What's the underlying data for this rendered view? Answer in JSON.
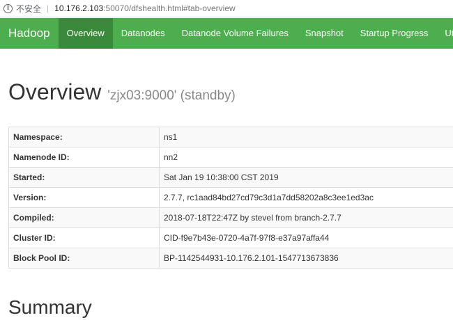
{
  "browser": {
    "security_label": "不安全",
    "url_host": "10.176.2.103",
    "url_rest": ":50070/dfshealth.html#tab-overview"
  },
  "navbar": {
    "brand": "Hadoop",
    "items": [
      "Overview",
      "Datanodes",
      "Datanode Volume Failures",
      "Snapshot",
      "Startup Progress",
      "Utilities"
    ]
  },
  "overview": {
    "title": "Overview",
    "subtitle": "'zjx03:9000' (standby)",
    "rows": [
      {
        "label": "Namespace:",
        "value": "ns1"
      },
      {
        "label": "Namenode ID:",
        "value": "nn2"
      },
      {
        "label": "Started:",
        "value": "Sat Jan 19 10:38:00 CST 2019"
      },
      {
        "label": "Version:",
        "value": "2.7.7, rc1aad84bd27cd79c3d1a7dd58202a8c3ee1ed3ac"
      },
      {
        "label": "Compiled:",
        "value": "2018-07-18T22:47Z by stevel from branch-2.7.7"
      },
      {
        "label": "Cluster ID:",
        "value": "CID-f9e7b43e-0720-4a7f-97f8-e37a97affa44"
      },
      {
        "label": "Block Pool ID:",
        "value": "BP-1142544931-10.176.2.101-1547713673836"
      }
    ]
  },
  "summary": {
    "title": "Summary"
  },
  "icons": {
    "security": "info-icon"
  },
  "colors": {
    "navbar": "#4cae4c",
    "navbar_active": "#3b8a3b"
  }
}
